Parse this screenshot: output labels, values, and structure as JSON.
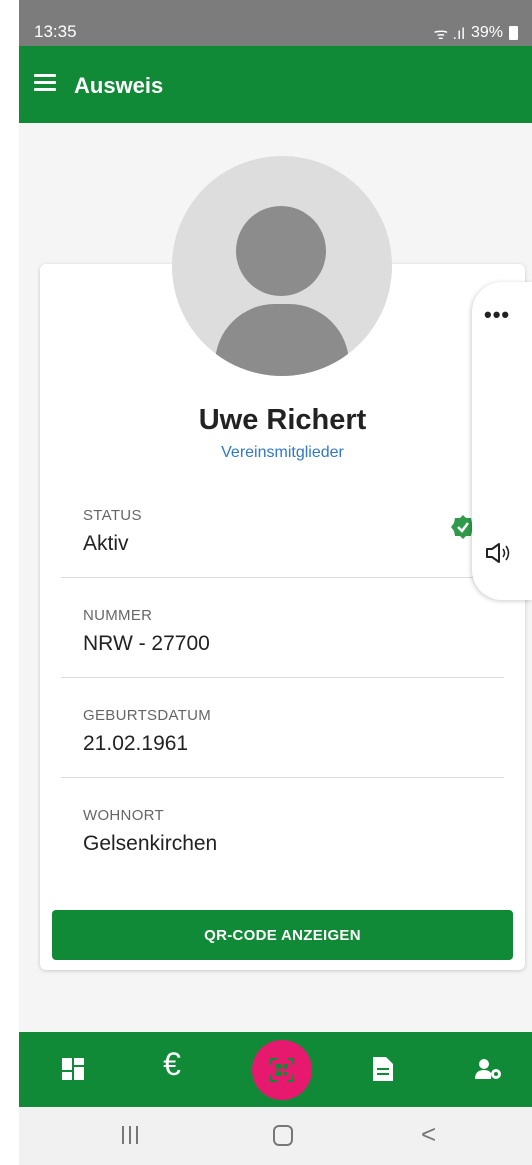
{
  "status_bar": {
    "time": "13:35",
    "signal": "ᯤ .ıl",
    "battery": "39%"
  },
  "app_bar": {
    "title": "Ausweis",
    "menu_icon": "hamburger-menu-icon"
  },
  "profile": {
    "name": "Uwe Richert",
    "group": "Vereinsmitglieder",
    "avatar_icon": "person-placeholder-icon"
  },
  "fields": [
    {
      "label": "STATUS",
      "value": "Aktiv",
      "verified": true
    },
    {
      "label": "NUMMER",
      "value": "NRW - 27700"
    },
    {
      "label": "GEBURTSDATUM",
      "value": "21.02.1961"
    },
    {
      "label": "WOHNORT",
      "value": "Gelsenkirchen"
    }
  ],
  "actions": {
    "qr_button": "QR-CODE ANZEIGEN"
  },
  "float_panel": {
    "more_label": "•••",
    "speaker_icon": "speaker-icon"
  },
  "bottom_nav": {
    "items": [
      "dashboard-icon",
      "euro-icon",
      "qr-code-icon",
      "document-icon",
      "user-settings-icon"
    ],
    "euro_symbol": "€",
    "fab_color": "#e6196e"
  },
  "colors": {
    "primary": "#118a37",
    "link": "#3178c6",
    "accent": "#e6196e"
  }
}
